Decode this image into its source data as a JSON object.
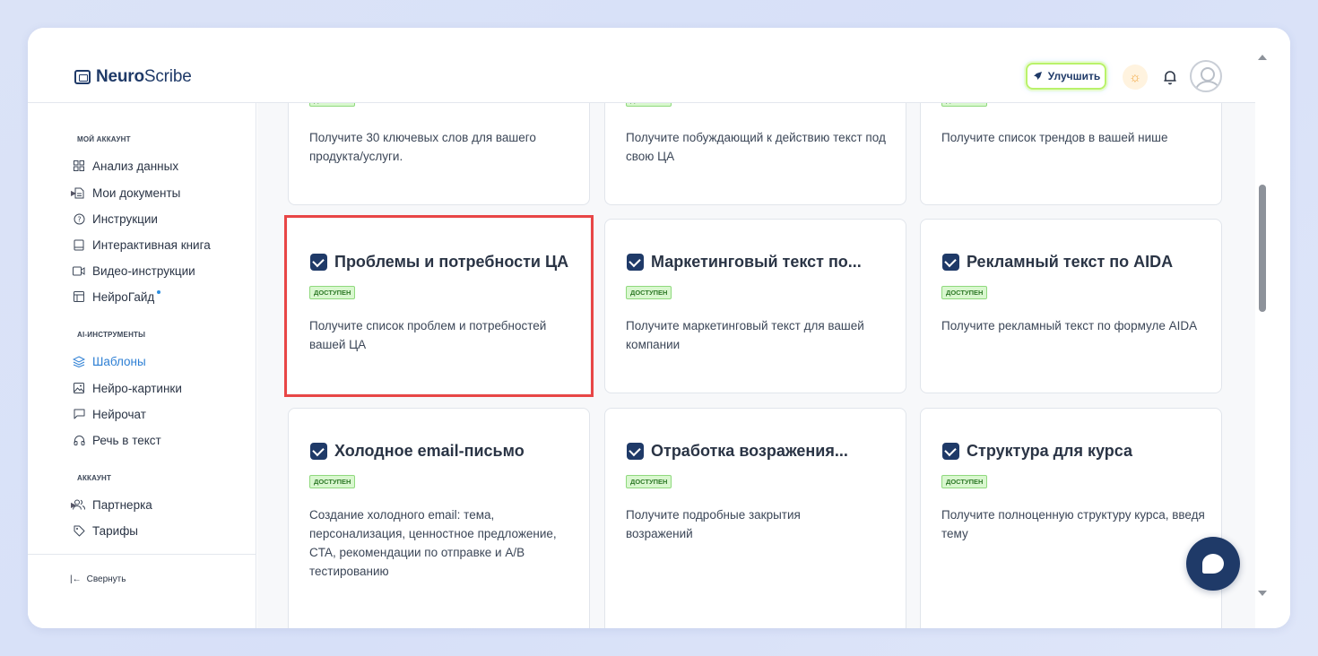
{
  "app": {
    "logo_bold": "Neuro",
    "logo_light": "Scribe"
  },
  "header": {
    "upgrade_label": "Улучшить"
  },
  "sidebar": {
    "section_account_title": "МОЙ АККАУНТ",
    "account_items": [
      {
        "label": "Анализ данных",
        "icon": "grid-icon"
      },
      {
        "label": "Мои документы",
        "icon": "document-icon"
      },
      {
        "label": "Инструкции",
        "icon": "help-circle-icon"
      },
      {
        "label": "Интерактивная книга",
        "icon": "book-icon"
      },
      {
        "label": "Видео-инструкции",
        "icon": "video-icon"
      },
      {
        "label": "НейроГайд",
        "icon": "guide-icon"
      }
    ],
    "section_ai_title": "AI-ИНСТРУМЕНТЫ",
    "ai_items": [
      {
        "label": "Шаблоны",
        "icon": "layers-icon"
      },
      {
        "label": "Нейро-картинки",
        "icon": "image-icon"
      },
      {
        "label": "Нейрочат",
        "icon": "chat-icon"
      },
      {
        "label": "Речь в текст",
        "icon": "headphones-icon"
      }
    ],
    "section_acc_title": "АККАУНТ",
    "acc_items": [
      {
        "label": "Партнерка",
        "icon": "users-icon"
      },
      {
        "label": "Тарифы",
        "icon": "tag-icon"
      }
    ],
    "collapse_label": "Свернуть"
  },
  "badge_text": "ДОСТУПЕН",
  "cards_top": [
    {
      "desc": "Получите 30 ключевых слов для вашего продукта/услуги."
    },
    {
      "desc": "Получите побуждающий к действию текст под свою ЦА"
    },
    {
      "desc": "Получите список трендов в вашей нише"
    }
  ],
  "cards_row2": [
    {
      "title": "Проблемы и потребности ЦА",
      "desc": "Получите список проблем и потребностей вашей ЦА"
    },
    {
      "title": "Маркетинговый текст по...",
      "desc": "Получите маркетинговый текст для вашей компании"
    },
    {
      "title": "Рекламный текст по AIDA",
      "desc": "Получите рекламный текст по формуле AIDA"
    }
  ],
  "cards_row3": [
    {
      "title": "Холодное email-письмо",
      "desc": "Создание холодного email: тема, персонализация, ценностное предложение, CTA, рекомендации по отправке и A/B тестированию"
    },
    {
      "title": "Отработка возражения...",
      "desc": "Получите подробные закрытия возражений"
    },
    {
      "title": "Структура для курса",
      "desc": "Получите полноценную структуру курса, введя тему"
    }
  ]
}
